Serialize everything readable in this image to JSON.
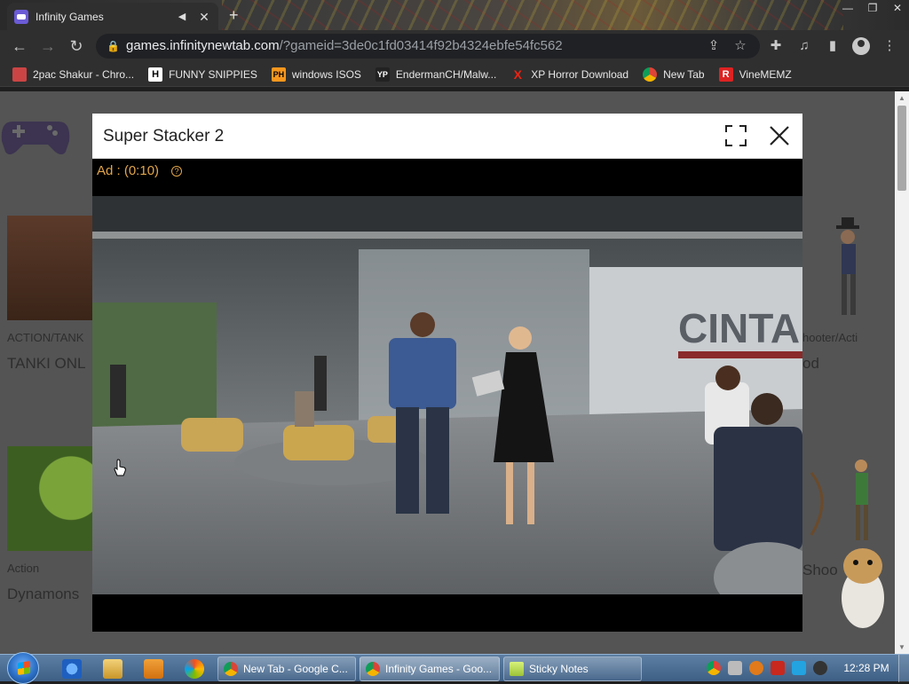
{
  "browser": {
    "tab": {
      "title": "Infinity Games"
    },
    "address": {
      "host": "games.infinitynewtab.com",
      "path": "/?gameid=3de0c1fd03414f92b4324ebfe54fc562"
    },
    "bookmarks": [
      {
        "label": "2pac Shakur - Chro...",
        "icon": "bookmark-icon",
        "color": "#c44"
      },
      {
        "label": "FUNNY SNIPPIES",
        "icon": "H",
        "color": "#fff"
      },
      {
        "label": "windows ISOS",
        "icon": "PH",
        "color": "#f7971e"
      },
      {
        "label": "EndermanCH/Malw...",
        "icon": "YP",
        "color": "#222"
      },
      {
        "label": "XP Horror Download",
        "icon": "X",
        "color": "#e21"
      },
      {
        "label": "New Tab",
        "icon": "chrome-icon",
        "color": "#4285f4"
      },
      {
        "label": "VineMEMZ",
        "icon": "R",
        "color": "#d22"
      }
    ]
  },
  "page": {
    "cards": [
      {
        "category": "ACTION/TANK",
        "name": "TANKI ONL"
      },
      {
        "category": "Action",
        "name": "Dynamons"
      },
      {
        "category": "hooter/Acti",
        "name": "od"
      },
      {
        "category": "",
        "name": "Shoo"
      }
    ]
  },
  "modal": {
    "title": "Super Stacker 2",
    "ad_text": "Ad : (0:10)",
    "help_glyph": "?",
    "video_sign": "CINTA"
  },
  "taskbar": {
    "tasks": [
      {
        "label": "New Tab - Google C..."
      },
      {
        "label": "Infinity Games - Goo..."
      },
      {
        "label": "Sticky Notes"
      }
    ],
    "clock": "12:28 PM"
  },
  "colors": {
    "ad_text": "#e2a64a",
    "page_dim": "#545454",
    "chrome_bg": "#2f2f2f"
  }
}
